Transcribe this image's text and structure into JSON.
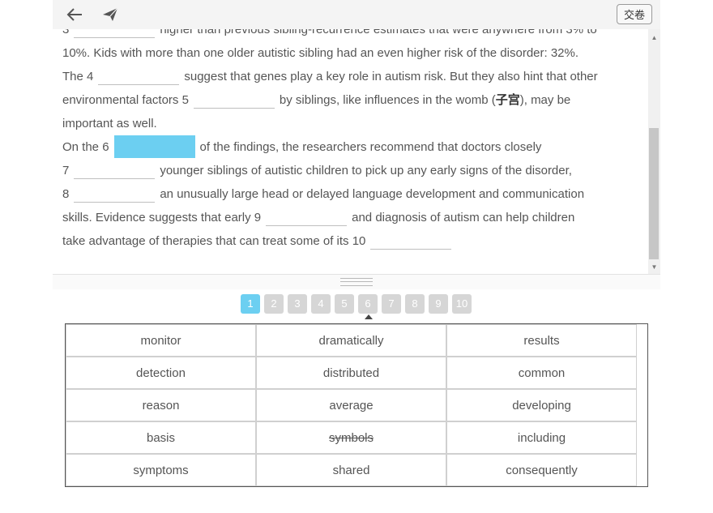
{
  "toolbar": {
    "back_icon": "back-arrow-icon",
    "send_icon": "send-icon",
    "submit_label": "交卷"
  },
  "passage": {
    "line1": {
      "num": "3",
      "after": "higher than previous sibling-recurrence estimates that were anywhere from 3% to"
    },
    "line2": "10%. Kids with more than one older autistic sibling had an even higher risk of the disorder: 32%.",
    "line3": {
      "before": "The 4",
      "after": "suggest that genes play a key role in autism risk. But they also hint that other"
    },
    "line4": {
      "before": "environmental factors 5",
      "after_pre": "by siblings, like influences in the womb (",
      "bold": "子宫",
      "after_post": "), may be"
    },
    "line5": "important as well.",
    "line6": {
      "before": "On the 6",
      "after": "of the findings, the researchers recommend that doctors closely"
    },
    "line7": {
      "num": "7",
      "after": "younger siblings of autistic children to pick up any early signs of the disorder,"
    },
    "line8": {
      "num": "8",
      "after": "an unusually large head or delayed language development and communication"
    },
    "line9": {
      "before": "skills. Evidence suggests that early 9",
      "after": "and diagnosis of autism can help children"
    },
    "line10": {
      "before": "take advantage of therapies that can treat some of its 10"
    }
  },
  "question_numbers": [
    "1",
    "2",
    "3",
    "4",
    "5",
    "6",
    "7",
    "8",
    "9",
    "10"
  ],
  "active_question": "1",
  "active_blank": "6",
  "word_bank": [
    [
      "monitor",
      "dramatically",
      "results"
    ],
    [
      "detection",
      "distributed",
      "common"
    ],
    [
      "reason",
      "average",
      "developing"
    ],
    [
      "basis",
      "symbols",
      "including"
    ],
    [
      "symptoms",
      "shared",
      "consequently"
    ]
  ],
  "used_words": [
    "symbols"
  ],
  "colors": {
    "accent": "#6ccff1",
    "inactive": "#d6d6d6"
  }
}
